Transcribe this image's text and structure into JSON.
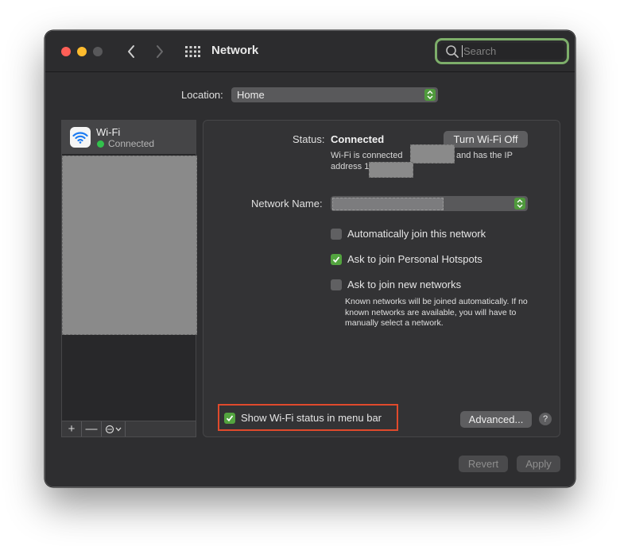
{
  "window": {
    "title": "Network",
    "search_placeholder": "Search",
    "icons": {
      "back": "chevron-left-icon",
      "forward": "chevron-right-icon",
      "grid": "grid-icon",
      "search": "search-icon"
    }
  },
  "location": {
    "label": "Location:",
    "value": "Home"
  },
  "sidebar": {
    "items": [
      {
        "name": "Wi-Fi",
        "status": "Connected",
        "status_color": "#32c14c",
        "icon": "wifi-icon"
      }
    ],
    "toolbar": {
      "add": "+",
      "remove": "—",
      "action_icon": "action-menu-icon"
    }
  },
  "detail": {
    "status_label": "Status:",
    "status_value": "Connected",
    "turn_off_button": "Turn Wi-Fi Off",
    "status_desc_part1": "Wi-Fi is connected",
    "status_desc_part2": "and has the IP",
    "status_desc_part3": "address 1",
    "network_name_label": "Network Name:",
    "checkboxes": [
      {
        "label": "Automatically join this network",
        "checked": false
      },
      {
        "label": "Ask to join Personal Hotspots",
        "checked": true
      },
      {
        "label": "Ask to join new networks",
        "checked": false
      }
    ],
    "hint": "Known networks will be joined automatically. If no known networks are available, you will have to manually select a network.",
    "show_status": {
      "label": "Show Wi-Fi status in menu bar",
      "checked": true
    },
    "advanced_button": "Advanced...",
    "help_button": "?"
  },
  "footer": {
    "revert": "Revert",
    "apply": "Apply"
  },
  "colors": {
    "accent_green": "#53a43f",
    "focus_ring": "#7dae6a",
    "highlight_box": "#e04a2c"
  }
}
